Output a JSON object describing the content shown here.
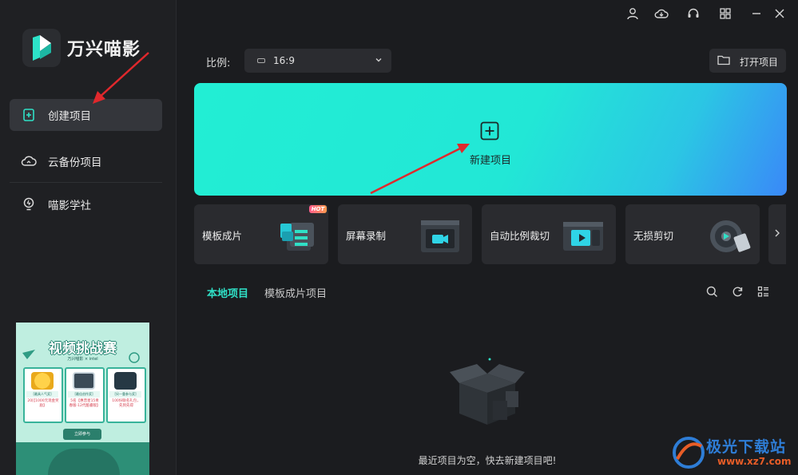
{
  "app": {
    "name": "万兴喵影"
  },
  "colors": {
    "accent": "#2fe0c6",
    "sidebar_bg": "#1f2023",
    "main_bg": "#1b1c1f",
    "card_bg": "#2a2b2f",
    "annotation_arrow": "#e0282c"
  },
  "sidebar": {
    "items": [
      {
        "label": "创建项目",
        "icon": "new-file-icon",
        "active": true
      },
      {
        "label": "云备份项目",
        "icon": "cloud-icon",
        "active": false
      },
      {
        "label": "喵影学社",
        "icon": "lightbulb-icon",
        "active": false
      }
    ],
    "banner": {
      "title": "视频挑战赛",
      "sub": "万兴喵影 × intel",
      "prizes": [
        {
          "tag": "[最具人气奖]",
          "text": "20[【1000元现金奖励】"
        },
        {
          "tag": "[最佳创作奖]",
          "text": "5名【惠普星15青春版-12代酷睿版】"
        },
        {
          "tag": "[另一重参与奖]",
          "text": "100份联名礼包，先到先得"
        }
      ],
      "button": "立即参与"
    }
  },
  "titlebar": {
    "icons": [
      "user-icon",
      "cloud-download-icon",
      "headset-icon",
      "grid-icon",
      "minimize-icon",
      "close-icon"
    ]
  },
  "toolbar": {
    "ratio_label": "比例:",
    "ratio_value": "16:9",
    "open_project": "打开项目"
  },
  "hero": {
    "label": "新建项目"
  },
  "cards": [
    {
      "label": "模板成片",
      "badge": "HOT"
    },
    {
      "label": "屏幕录制"
    },
    {
      "label": "自动比例裁切"
    },
    {
      "label": "无损剪切"
    }
  ],
  "tabs": [
    {
      "label": "本地项目",
      "active": true
    },
    {
      "label": "模板成片项目",
      "active": false
    }
  ],
  "list_tools": [
    "search-icon",
    "refresh-icon",
    "list-view-icon"
  ],
  "empty_state": {
    "text": "最近项目为空，快去新建项目吧!"
  },
  "watermark": {
    "cn": "极光下载站",
    "en": "www.xz7.com"
  }
}
